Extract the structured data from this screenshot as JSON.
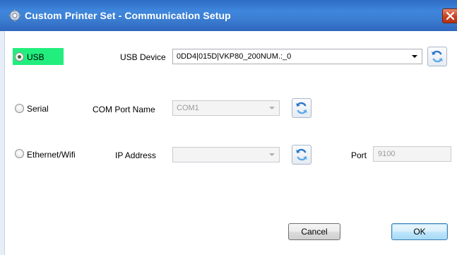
{
  "window": {
    "title": "Custom Printer Set - Communication Setup"
  },
  "usb": {
    "radio_label": "USB",
    "selected": true,
    "highlight_color": "#22ee7d",
    "device_label": "USB Device",
    "device_value": "0DD4|015D|VKP80_200NUM.:_0"
  },
  "serial": {
    "radio_label": "Serial",
    "selected": false,
    "port_label": "COM Port Name",
    "port_value": "COM1"
  },
  "ethernet": {
    "radio_label": "Ethernet/Wifi",
    "selected": false,
    "ip_label": "IP Address",
    "ip_value": "",
    "port_label": "Port",
    "port_value": "9100"
  },
  "buttons": {
    "cancel": "Cancel",
    "ok": "OK"
  },
  "icons": {
    "app": "printer-settings-icon",
    "close": "close-icon",
    "refresh": "refresh-icon",
    "dropdown": "chevron-down-icon"
  },
  "colors": {
    "titlebar": "#3c7fd3",
    "close": "#c9411f"
  }
}
